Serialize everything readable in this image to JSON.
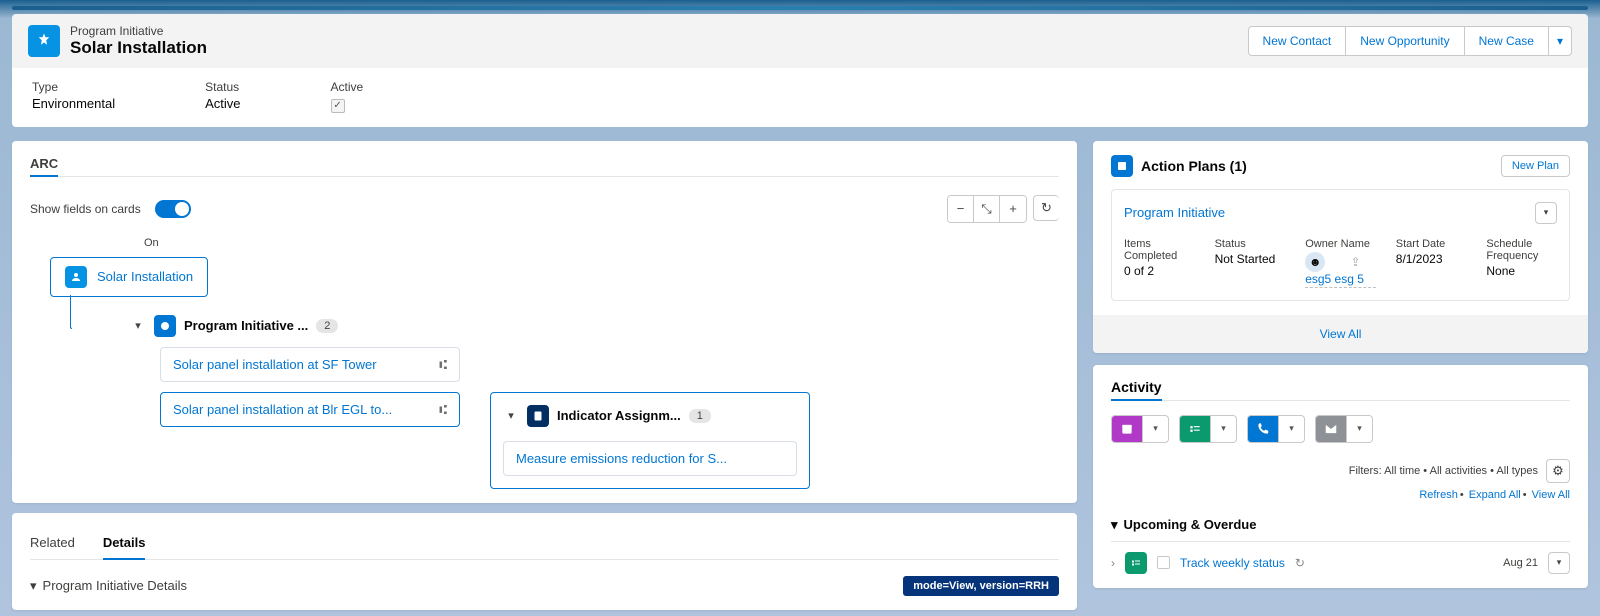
{
  "header": {
    "record_type_label": "Program Initiative",
    "title": "Solar Installation",
    "actions": {
      "new_contact": "New Contact",
      "new_opportunity": "New Opportunity",
      "new_case": "New Case"
    }
  },
  "highlights": {
    "type_label": "Type",
    "type_value": "Environmental",
    "status_label": "Status",
    "status_value": "Active",
    "active_label": "Active"
  },
  "arc": {
    "title": "ARC",
    "toggle_label": "Show fields on cards",
    "toggle_state": "On",
    "root": "Solar Installation",
    "group_label": "Program Initiative ...",
    "group_count": "2",
    "children": [
      "Solar panel installation at SF Tower",
      "Solar panel installation at Blr EGL to..."
    ],
    "indicator_label": "Indicator Assignm...",
    "indicator_count": "1",
    "indicator_item": "Measure emissions reduction for S..."
  },
  "tabs": {
    "related": "Related",
    "details": "Details",
    "section": "Program Initiative Details",
    "mode_badge": "mode=View, version=RRH"
  },
  "action_plans": {
    "title": "Action Plans (1)",
    "new_plan": "New Plan",
    "item_title": "Program Initiative",
    "items_completed_label": "Items Completed",
    "items_completed_value": "0 of 2",
    "status_label": "Status",
    "status_value": "Not Started",
    "owner_label": "Owner Name",
    "owner_value": "esg5 esg 5",
    "start_label": "Start Date",
    "start_value": "8/1/2023",
    "freq_label": "Schedule Frequency",
    "freq_value": "None",
    "view_all": "View All"
  },
  "activity": {
    "title": "Activity",
    "filters": "Filters: All time • All activities • All types",
    "refresh": "Refresh",
    "expand_all": "Expand All",
    "view_all": "View All",
    "upcoming": "Upcoming & Overdue",
    "task_title": "Track weekly status",
    "task_date": "Aug 21"
  }
}
